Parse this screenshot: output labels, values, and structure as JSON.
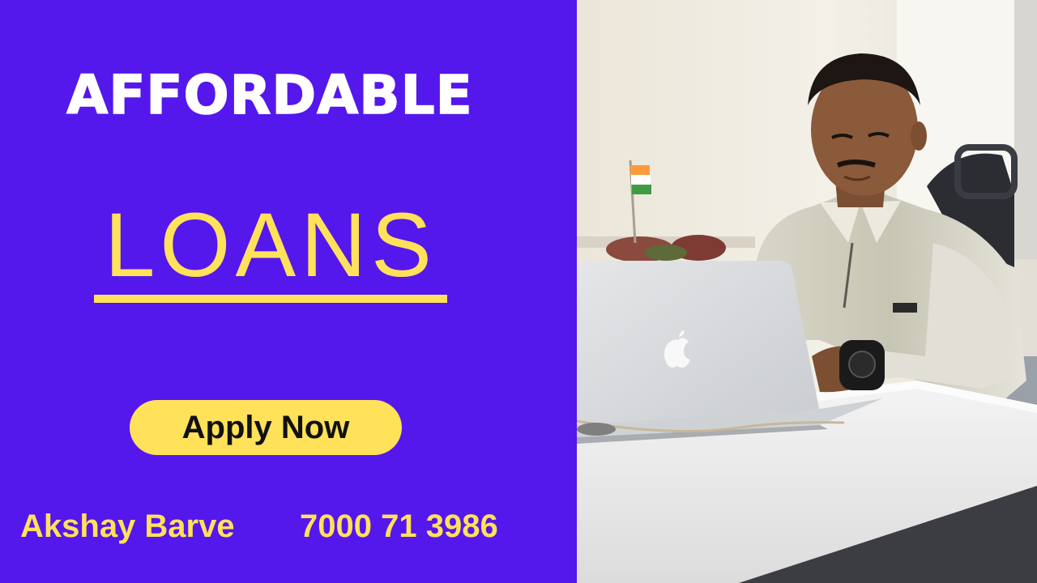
{
  "banner": {
    "headline_top": "AFFORDABLE",
    "headline_main": "LOANS",
    "cta_label": "Apply Now",
    "contact_name": "Akshay Barve",
    "contact_phone": "7000 71 3986"
  },
  "colors": {
    "panel_bg": "#5417ec",
    "accent_yellow": "#ffe15a",
    "headline_white": "#ffffff"
  },
  "photo": {
    "subject": "man-working-on-laptop",
    "icons": [
      "laptop-icon",
      "indian-flag-icon",
      "wristwatch-icon",
      "apple-logo-icon"
    ]
  }
}
